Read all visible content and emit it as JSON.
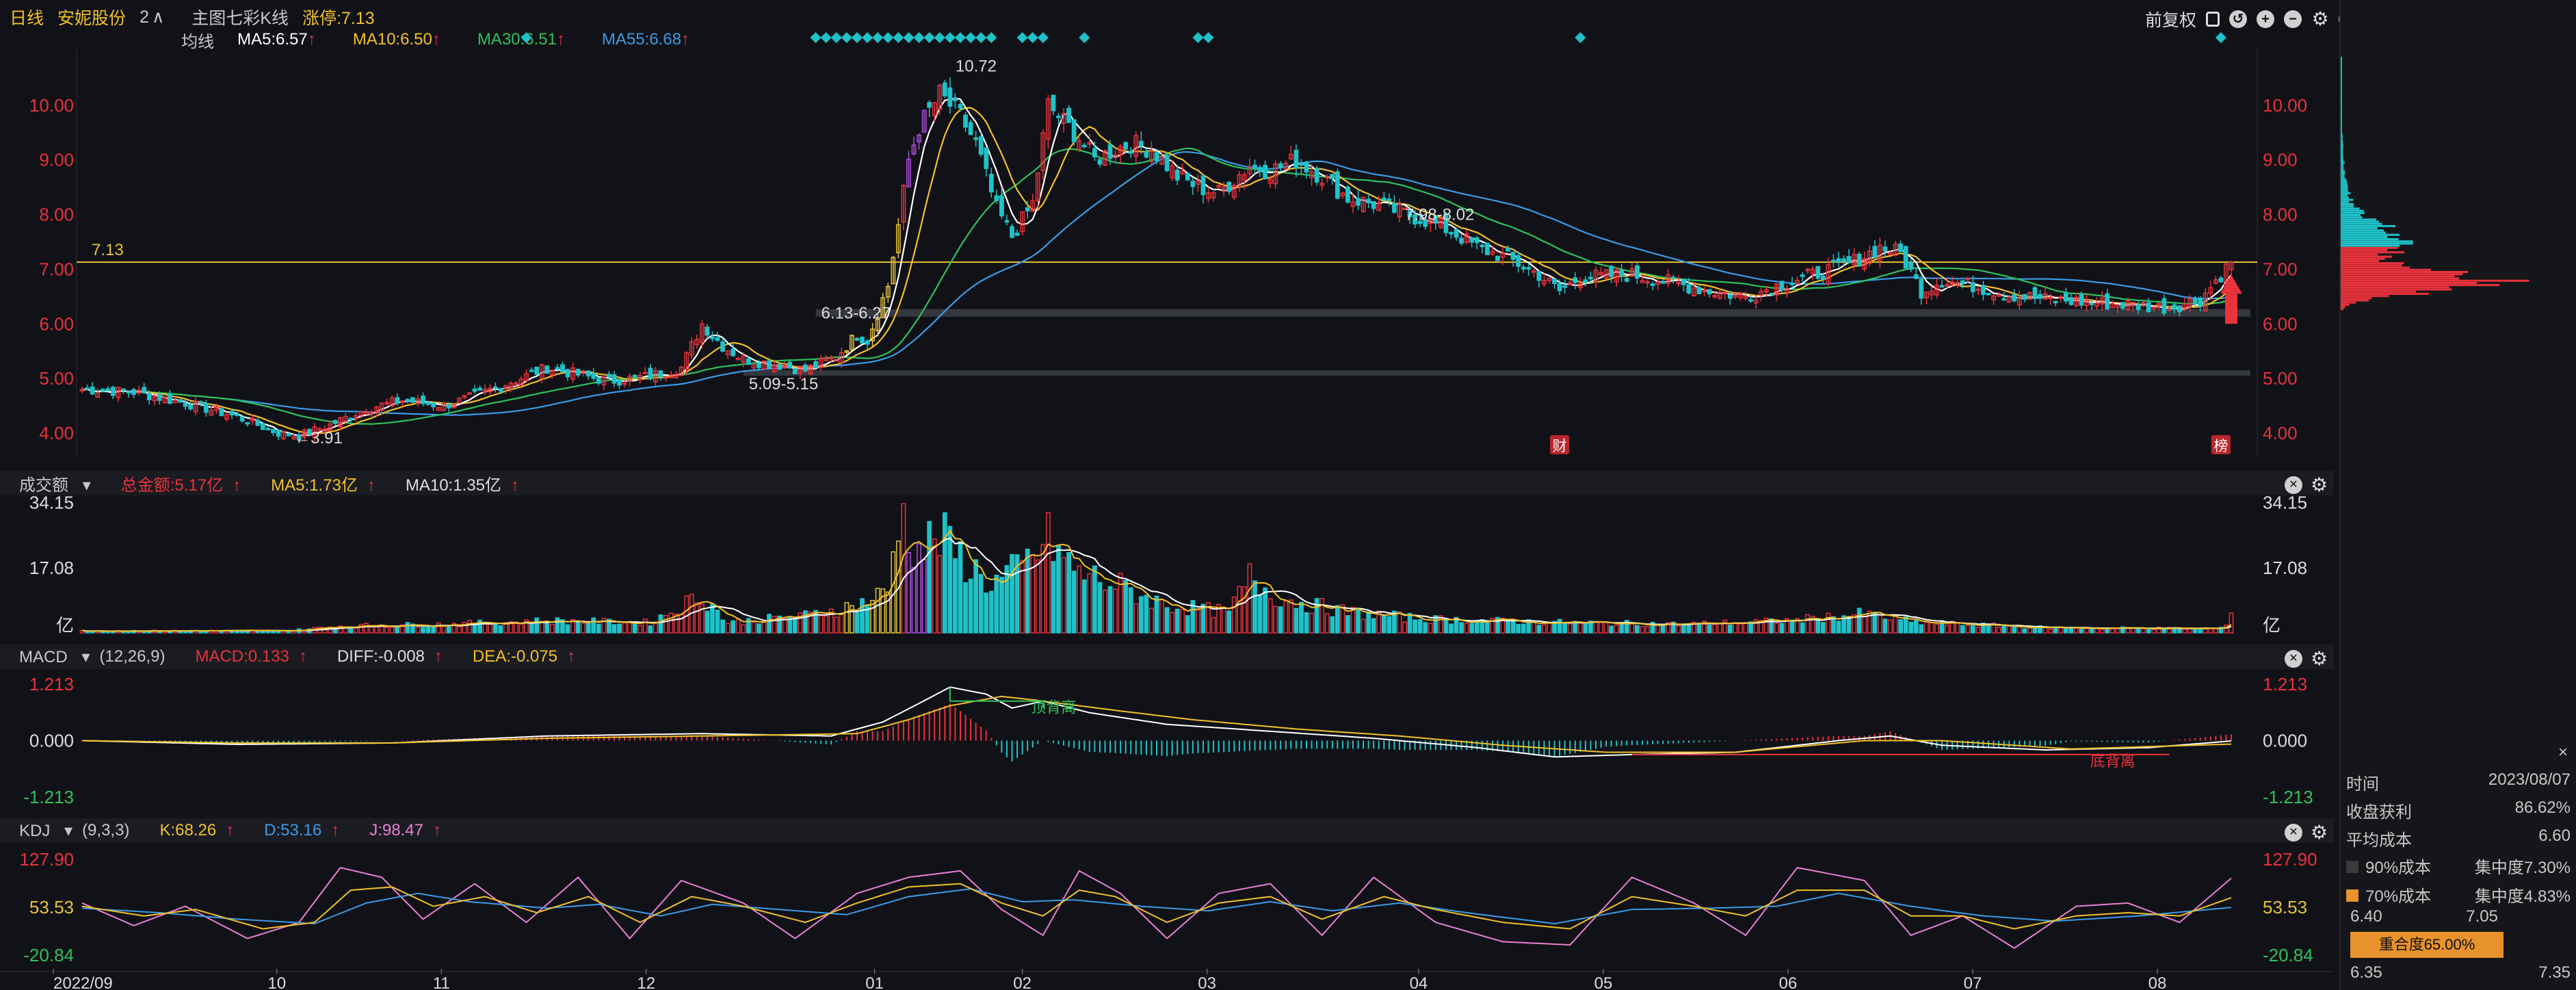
{
  "header": {
    "period": "日线",
    "stock_name": "安妮股份",
    "count": "2",
    "chevron": "∧",
    "main_chart": "主图七彩K线",
    "limit_up": "涨停:7.13",
    "adjust": "前复权"
  },
  "ma_legend": {
    "label": "均线",
    "items": [
      {
        "text": "MA5:6.57",
        "color": "#ffffff"
      },
      {
        "text": "MA10:6.50",
        "color": "#f2c02b"
      },
      {
        "text": "MA30:6.51",
        "color": "#2ec25c"
      },
      {
        "text": "MA55:6.68",
        "color": "#3a9be8"
      }
    ],
    "arrow": "↑"
  },
  "volume_bar": {
    "label": "成交额",
    "dropdown": "▾",
    "total": "总金额:5.17亿",
    "ma5": "MA5:1.73亿",
    "ma10": "MA10:1.35亿",
    "arrow": "↑"
  },
  "macd_bar": {
    "label": "MACD",
    "dropdown": "▾",
    "params": "(12,26,9)",
    "macd": "MACD:0.133",
    "diff": "DIFF:-0.008",
    "dea": "DEA:-0.075",
    "arrow": "↑"
  },
  "kdj_bar": {
    "label": "KDJ",
    "dropdown": "▾",
    "params": "(9,3,3)",
    "k": "K:68.26",
    "d": "D:53.16",
    "j": "J:98.47",
    "arrow": "↑"
  },
  "icons": {
    "close": "✕",
    "gear": "⚙",
    "help": "?",
    "plus": "+",
    "minus": "−",
    "undo": "↺",
    "lock": "🔒"
  },
  "colors": {
    "up": "#e8323c",
    "down": "#1fc2c9",
    "ma5": "#ffffff",
    "ma10": "#f2c02b",
    "ma30": "#2ec25c",
    "ma55": "#3a9be8",
    "limit_line": "#e7c23a",
    "purple": "#b44fe8",
    "k": "#f2c02b",
    "d": "#3a9be8",
    "j": "#e97fd6"
  },
  "chart_data": [
    {
      "type": "candlestick",
      "x_ticks": [
        "2022/09",
        "10",
        "11",
        "12",
        "01",
        "02",
        "03",
        "04",
        "05",
        "06",
        "07",
        "08"
      ],
      "y_ticks": [
        "4.00",
        "5.00",
        "6.00",
        "7.00",
        "8.00",
        "9.00",
        "10.00"
      ],
      "ylim": [
        3.6,
        10.9
      ],
      "close_keypoints": [
        [
          0,
          4.8
        ],
        [
          10,
          4.75
        ],
        [
          20,
          4.55
        ],
        [
          30,
          4.3
        ],
        [
          38,
          4.0
        ],
        [
          42,
          3.95
        ],
        [
          48,
          4.15
        ],
        [
          55,
          4.45
        ],
        [
          62,
          4.6
        ],
        [
          70,
          4.5
        ],
        [
          75,
          4.65
        ],
        [
          82,
          4.9
        ],
        [
          90,
          5.2
        ],
        [
          97,
          5.05
        ],
        [
          102,
          4.95
        ],
        [
          110,
          5.05
        ],
        [
          116,
          5.2
        ],
        [
          120,
          6.0
        ],
        [
          124,
          5.6
        ],
        [
          128,
          5.35
        ],
        [
          135,
          5.25
        ],
        [
          140,
          5.15
        ],
        [
          146,
          5.4
        ],
        [
          150,
          5.8
        ],
        [
          152,
          5.7
        ],
        [
          154,
          6.2
        ],
        [
          156,
          6.7
        ],
        [
          158,
          7.8
        ],
        [
          160,
          9.0
        ],
        [
          162,
          9.6
        ],
        [
          166,
          10.2
        ],
        [
          170,
          9.8
        ],
        [
          173,
          9.3
        ],
        [
          177,
          8.1
        ],
        [
          180,
          7.6
        ],
        [
          184,
          8.2
        ],
        [
          187,
          10.0
        ],
        [
          190,
          9.7
        ],
        [
          193,
          9.4
        ],
        [
          196,
          9.0
        ],
        [
          200,
          9.2
        ],
        [
          203,
          9.3
        ],
        [
          207,
          9.2
        ],
        [
          212,
          8.7
        ],
        [
          216,
          8.5
        ],
        [
          220,
          8.4
        ],
        [
          226,
          8.9
        ],
        [
          230,
          8.8
        ],
        [
          235,
          9.0
        ],
        [
          240,
          8.7
        ],
        [
          245,
          8.3
        ],
        [
          250,
          8.2
        ],
        [
          255,
          8.05
        ],
        [
          260,
          7.9
        ],
        [
          265,
          7.7
        ],
        [
          270,
          7.4
        ],
        [
          276,
          7.2
        ],
        [
          282,
          6.9
        ],
        [
          286,
          6.6
        ],
        [
          290,
          6.85
        ],
        [
          300,
          6.9
        ],
        [
          308,
          6.75
        ],
        [
          315,
          6.6
        ],
        [
          322,
          6.5
        ],
        [
          328,
          6.7
        ],
        [
          335,
          6.9
        ],
        [
          342,
          7.1
        ],
        [
          348,
          7.4
        ],
        [
          352,
          7.3
        ],
        [
          356,
          6.6
        ],
        [
          360,
          6.8
        ],
        [
          366,
          6.7
        ],
        [
          372,
          6.55
        ],
        [
          380,
          6.45
        ],
        [
          388,
          6.4
        ],
        [
          396,
          6.35
        ],
        [
          404,
          6.3
        ],
        [
          410,
          6.45
        ],
        [
          416,
          7.13
        ]
      ],
      "annotations": [
        {
          "text": "10.72",
          "x_index": 168,
          "value": 10.72
        },
        {
          "text": "←3.91",
          "x_index": 40,
          "value": 3.91
        },
        {
          "text": "6.13-6.27",
          "x_index": 142,
          "value": 6.2
        },
        {
          "text": "5.09-5.15",
          "x_index": 128,
          "value": 4.9
        },
        {
          "text": "7.98-8.02",
          "x_index": 255,
          "value": 8.0
        }
      ],
      "limit_line": {
        "value": 7.13,
        "label": "7.13"
      },
      "support_bands": [
        {
          "from": 6.13,
          "to": 6.27,
          "start_index": 142
        },
        {
          "from": 5.09,
          "to": 5.15,
          "start_index": 128
        }
      ],
      "badges": [
        {
          "text": "财",
          "x_index": 286
        },
        {
          "text": "榜",
          "x_index": 414
        }
      ]
    },
    {
      "type": "bar",
      "y_ticks": [
        "34.15",
        "17.08"
      ],
      "unit": "亿",
      "ylim": [
        0,
        35
      ],
      "volume_keypoints": [
        [
          0,
          0.6
        ],
        [
          40,
          0.6
        ],
        [
          50,
          2.0
        ],
        [
          70,
          2.5
        ],
        [
          90,
          3.5
        ],
        [
          110,
          3.0
        ],
        [
          120,
          11.0
        ],
        [
          125,
          3.0
        ],
        [
          140,
          5.0
        ],
        [
          150,
          8.0
        ],
        [
          156,
          12.0
        ],
        [
          158,
          35.0
        ],
        [
          162,
          24.0
        ],
        [
          166,
          28.0
        ],
        [
          170,
          22.0
        ],
        [
          176,
          14.0
        ],
        [
          182,
          19.0
        ],
        [
          187,
          27.0
        ],
        [
          192,
          18.0
        ],
        [
          200,
          14.0
        ],
        [
          210,
          8.0
        ],
        [
          222,
          6.0
        ],
        [
          226,
          16.0
        ],
        [
          232,
          10.0
        ],
        [
          245,
          6.0
        ],
        [
          260,
          4.0
        ],
        [
          285,
          3.0
        ],
        [
          310,
          2.5
        ],
        [
          330,
          3.5
        ],
        [
          345,
          5.5
        ],
        [
          355,
          3.0
        ],
        [
          380,
          1.5
        ],
        [
          414,
          1.2
        ],
        [
          416,
          5.17
        ]
      ]
    },
    {
      "type": "line",
      "name_source": "MACD",
      "y_ticks": [
        "1.213",
        "0.000",
        "-1.213"
      ],
      "ylim": [
        -1.213,
        1.213
      ],
      "labels": [
        {
          "text": "顶背离",
          "x_index": 185
        },
        {
          "text": "底背离",
          "x_index": 390
        }
      ],
      "diff_keypoints": [
        [
          0,
          0.0
        ],
        [
          30,
          -0.08
        ],
        [
          60,
          -0.05
        ],
        [
          90,
          0.1
        ],
        [
          120,
          0.15
        ],
        [
          145,
          0.1
        ],
        [
          155,
          0.4
        ],
        [
          162,
          0.8
        ],
        [
          168,
          1.15
        ],
        [
          175,
          1.0
        ],
        [
          180,
          0.7
        ],
        [
          186,
          0.85
        ],
        [
          195,
          0.6
        ],
        [
          210,
          0.35
        ],
        [
          230,
          0.2
        ],
        [
          250,
          0.05
        ],
        [
          270,
          -0.15
        ],
        [
          285,
          -0.35
        ],
        [
          300,
          -0.3
        ],
        [
          320,
          -0.25
        ],
        [
          340,
          0.0
        ],
        [
          350,
          0.1
        ],
        [
          360,
          -0.1
        ],
        [
          380,
          -0.2
        ],
        [
          400,
          -0.15
        ],
        [
          416,
          -0.008
        ]
      ],
      "dea_keypoints": [
        [
          0,
          0.0
        ],
        [
          30,
          -0.05
        ],
        [
          60,
          -0.05
        ],
        [
          90,
          0.05
        ],
        [
          120,
          0.1
        ],
        [
          150,
          0.15
        ],
        [
          160,
          0.45
        ],
        [
          168,
          0.75
        ],
        [
          178,
          0.95
        ],
        [
          186,
          0.85
        ],
        [
          200,
          0.65
        ],
        [
          215,
          0.45
        ],
        [
          235,
          0.25
        ],
        [
          255,
          0.1
        ],
        [
          275,
          -0.1
        ],
        [
          295,
          -0.25
        ],
        [
          320,
          -0.25
        ],
        [
          345,
          0.0
        ],
        [
          360,
          0.0
        ],
        [
          385,
          -0.18
        ],
        [
          416,
          -0.075
        ]
      ]
    },
    {
      "type": "line",
      "name_source": "KDJ",
      "y_ticks": [
        "127.90",
        "53.53",
        "-20.84"
      ],
      "ylim": [
        -20.84,
        127.9
      ],
      "k_keypoints": [
        [
          0,
          55
        ],
        [
          12,
          40
        ],
        [
          22,
          50
        ],
        [
          35,
          20
        ],
        [
          45,
          30
        ],
        [
          52,
          80
        ],
        [
          60,
          85
        ],
        [
          68,
          55
        ],
        [
          78,
          70
        ],
        [
          88,
          45
        ],
        [
          98,
          70
        ],
        [
          108,
          30
        ],
        [
          118,
          70
        ],
        [
          128,
          55
        ],
        [
          140,
          30
        ],
        [
          150,
          60
        ],
        [
          160,
          85
        ],
        [
          170,
          90
        ],
        [
          178,
          60
        ],
        [
          186,
          40
        ],
        [
          193,
          80
        ],
        [
          200,
          70
        ],
        [
          210,
          30
        ],
        [
          220,
          60
        ],
        [
          230,
          70
        ],
        [
          240,
          35
        ],
        [
          252,
          70
        ],
        [
          262,
          50
        ],
        [
          275,
          30
        ],
        [
          288,
          20
        ],
        [
          300,
          70
        ],
        [
          312,
          55
        ],
        [
          322,
          40
        ],
        [
          332,
          80
        ],
        [
          345,
          80
        ],
        [
          354,
          40
        ],
        [
          364,
          40
        ],
        [
          374,
          20
        ],
        [
          386,
          40
        ],
        [
          396,
          45
        ],
        [
          406,
          40
        ],
        [
          416,
          68.26
        ]
      ],
      "d_keypoints": [
        [
          0,
          52
        ],
        [
          15,
          45
        ],
        [
          30,
          35
        ],
        [
          45,
          28
        ],
        [
          55,
          60
        ],
        [
          65,
          75
        ],
        [
          75,
          62
        ],
        [
          90,
          52
        ],
        [
          100,
          58
        ],
        [
          112,
          40
        ],
        [
          122,
          58
        ],
        [
          135,
          50
        ],
        [
          148,
          42
        ],
        [
          160,
          70
        ],
        [
          172,
          82
        ],
        [
          182,
          62
        ],
        [
          192,
          65
        ],
        [
          205,
          55
        ],
        [
          218,
          48
        ],
        [
          230,
          62
        ],
        [
          242,
          48
        ],
        [
          255,
          60
        ],
        [
          268,
          45
        ],
        [
          285,
          28
        ],
        [
          300,
          50
        ],
        [
          315,
          52
        ],
        [
          328,
          55
        ],
        [
          340,
          75
        ],
        [
          354,
          55
        ],
        [
          368,
          40
        ],
        [
          382,
          32
        ],
        [
          398,
          40
        ],
        [
          416,
          53.16
        ]
      ],
      "j_keypoints": [
        [
          0,
          60
        ],
        [
          10,
          25
        ],
        [
          20,
          55
        ],
        [
          32,
          5
        ],
        [
          42,
          30
        ],
        [
          50,
          115
        ],
        [
          58,
          100
        ],
        [
          66,
          35
        ],
        [
          76,
          90
        ],
        [
          86,
          30
        ],
        [
          96,
          100
        ],
        [
          106,
          5
        ],
        [
          116,
          95
        ],
        [
          128,
          60
        ],
        [
          138,
          5
        ],
        [
          150,
          75
        ],
        [
          160,
          100
        ],
        [
          170,
          110
        ],
        [
          178,
          50
        ],
        [
          186,
          10
        ],
        [
          193,
          110
        ],
        [
          201,
          75
        ],
        [
          210,
          5
        ],
        [
          220,
          75
        ],
        [
          230,
          90
        ],
        [
          240,
          10
        ],
        [
          250,
          100
        ],
        [
          262,
          30
        ],
        [
          275,
          0
        ],
        [
          288,
          -5
        ],
        [
          300,
          100
        ],
        [
          312,
          60
        ],
        [
          322,
          10
        ],
        [
          332,
          115
        ],
        [
          345,
          95
        ],
        [
          354,
          10
        ],
        [
          364,
          40
        ],
        [
          374,
          -10
        ],
        [
          386,
          55
        ],
        [
          396,
          60
        ],
        [
          406,
          30
        ],
        [
          416,
          98.47
        ]
      ]
    }
  ],
  "sidebar": {
    "close": "×",
    "rows": [
      {
        "label": "时间",
        "value": "2023/08/07"
      },
      {
        "label": "收盘获利",
        "value": "86.62%"
      },
      {
        "label": "平均成本",
        "value": "6.60"
      }
    ],
    "c90": {
      "label": "90%成本",
      "value": "集中度7.30%",
      "lo": "6.35",
      "hi": "7.35"
    },
    "c70": {
      "label": "70%成本",
      "value": "集中度4.83%",
      "lo": "6.40",
      "hi": "7.05"
    },
    "overlap": "重合度65.00%",
    "bottom_lo": "6.35",
    "bottom_hi": "7.35"
  }
}
